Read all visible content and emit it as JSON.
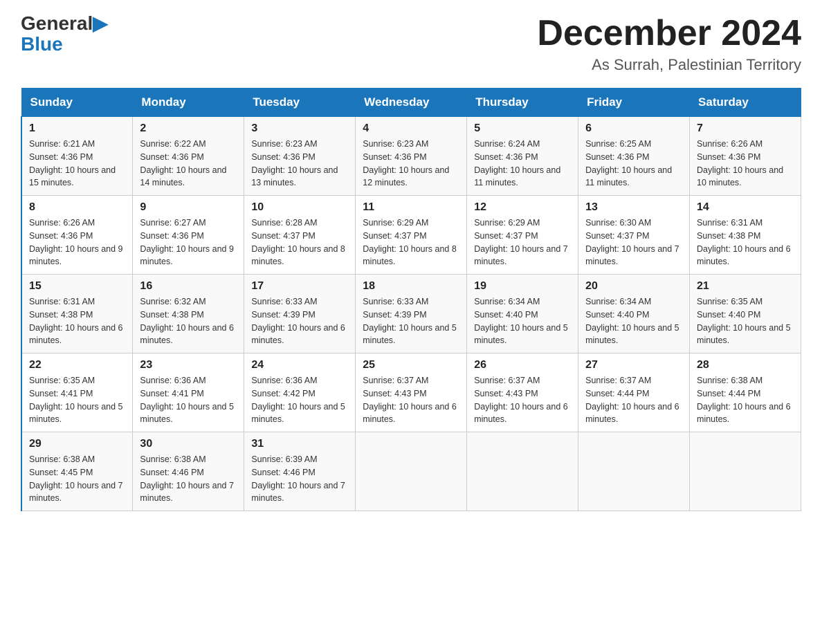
{
  "header": {
    "logo_general": "General",
    "logo_blue": "Blue",
    "month_title": "December 2024",
    "location": "As Surrah, Palestinian Territory"
  },
  "days_of_week": [
    "Sunday",
    "Monday",
    "Tuesday",
    "Wednesday",
    "Thursday",
    "Friday",
    "Saturday"
  ],
  "weeks": [
    [
      {
        "num": "1",
        "sunrise": "6:21 AM",
        "sunset": "4:36 PM",
        "daylight": "10 hours and 15 minutes."
      },
      {
        "num": "2",
        "sunrise": "6:22 AM",
        "sunset": "4:36 PM",
        "daylight": "10 hours and 14 minutes."
      },
      {
        "num": "3",
        "sunrise": "6:23 AM",
        "sunset": "4:36 PM",
        "daylight": "10 hours and 13 minutes."
      },
      {
        "num": "4",
        "sunrise": "6:23 AM",
        "sunset": "4:36 PM",
        "daylight": "10 hours and 12 minutes."
      },
      {
        "num": "5",
        "sunrise": "6:24 AM",
        "sunset": "4:36 PM",
        "daylight": "10 hours and 11 minutes."
      },
      {
        "num": "6",
        "sunrise": "6:25 AM",
        "sunset": "4:36 PM",
        "daylight": "10 hours and 11 minutes."
      },
      {
        "num": "7",
        "sunrise": "6:26 AM",
        "sunset": "4:36 PM",
        "daylight": "10 hours and 10 minutes."
      }
    ],
    [
      {
        "num": "8",
        "sunrise": "6:26 AM",
        "sunset": "4:36 PM",
        "daylight": "10 hours and 9 minutes."
      },
      {
        "num": "9",
        "sunrise": "6:27 AM",
        "sunset": "4:36 PM",
        "daylight": "10 hours and 9 minutes."
      },
      {
        "num": "10",
        "sunrise": "6:28 AM",
        "sunset": "4:37 PM",
        "daylight": "10 hours and 8 minutes."
      },
      {
        "num": "11",
        "sunrise": "6:29 AM",
        "sunset": "4:37 PM",
        "daylight": "10 hours and 8 minutes."
      },
      {
        "num": "12",
        "sunrise": "6:29 AM",
        "sunset": "4:37 PM",
        "daylight": "10 hours and 7 minutes."
      },
      {
        "num": "13",
        "sunrise": "6:30 AM",
        "sunset": "4:37 PM",
        "daylight": "10 hours and 7 minutes."
      },
      {
        "num": "14",
        "sunrise": "6:31 AM",
        "sunset": "4:38 PM",
        "daylight": "10 hours and 6 minutes."
      }
    ],
    [
      {
        "num": "15",
        "sunrise": "6:31 AM",
        "sunset": "4:38 PM",
        "daylight": "10 hours and 6 minutes."
      },
      {
        "num": "16",
        "sunrise": "6:32 AM",
        "sunset": "4:38 PM",
        "daylight": "10 hours and 6 minutes."
      },
      {
        "num": "17",
        "sunrise": "6:33 AM",
        "sunset": "4:39 PM",
        "daylight": "10 hours and 6 minutes."
      },
      {
        "num": "18",
        "sunrise": "6:33 AM",
        "sunset": "4:39 PM",
        "daylight": "10 hours and 5 minutes."
      },
      {
        "num": "19",
        "sunrise": "6:34 AM",
        "sunset": "4:40 PM",
        "daylight": "10 hours and 5 minutes."
      },
      {
        "num": "20",
        "sunrise": "6:34 AM",
        "sunset": "4:40 PM",
        "daylight": "10 hours and 5 minutes."
      },
      {
        "num": "21",
        "sunrise": "6:35 AM",
        "sunset": "4:40 PM",
        "daylight": "10 hours and 5 minutes."
      }
    ],
    [
      {
        "num": "22",
        "sunrise": "6:35 AM",
        "sunset": "4:41 PM",
        "daylight": "10 hours and 5 minutes."
      },
      {
        "num": "23",
        "sunrise": "6:36 AM",
        "sunset": "4:41 PM",
        "daylight": "10 hours and 5 minutes."
      },
      {
        "num": "24",
        "sunrise": "6:36 AM",
        "sunset": "4:42 PM",
        "daylight": "10 hours and 5 minutes."
      },
      {
        "num": "25",
        "sunrise": "6:37 AM",
        "sunset": "4:43 PM",
        "daylight": "10 hours and 6 minutes."
      },
      {
        "num": "26",
        "sunrise": "6:37 AM",
        "sunset": "4:43 PM",
        "daylight": "10 hours and 6 minutes."
      },
      {
        "num": "27",
        "sunrise": "6:37 AM",
        "sunset": "4:44 PM",
        "daylight": "10 hours and 6 minutes."
      },
      {
        "num": "28",
        "sunrise": "6:38 AM",
        "sunset": "4:44 PM",
        "daylight": "10 hours and 6 minutes."
      }
    ],
    [
      {
        "num": "29",
        "sunrise": "6:38 AM",
        "sunset": "4:45 PM",
        "daylight": "10 hours and 7 minutes."
      },
      {
        "num": "30",
        "sunrise": "6:38 AM",
        "sunset": "4:46 PM",
        "daylight": "10 hours and 7 minutes."
      },
      {
        "num": "31",
        "sunrise": "6:39 AM",
        "sunset": "4:46 PM",
        "daylight": "10 hours and 7 minutes."
      },
      null,
      null,
      null,
      null
    ]
  ]
}
